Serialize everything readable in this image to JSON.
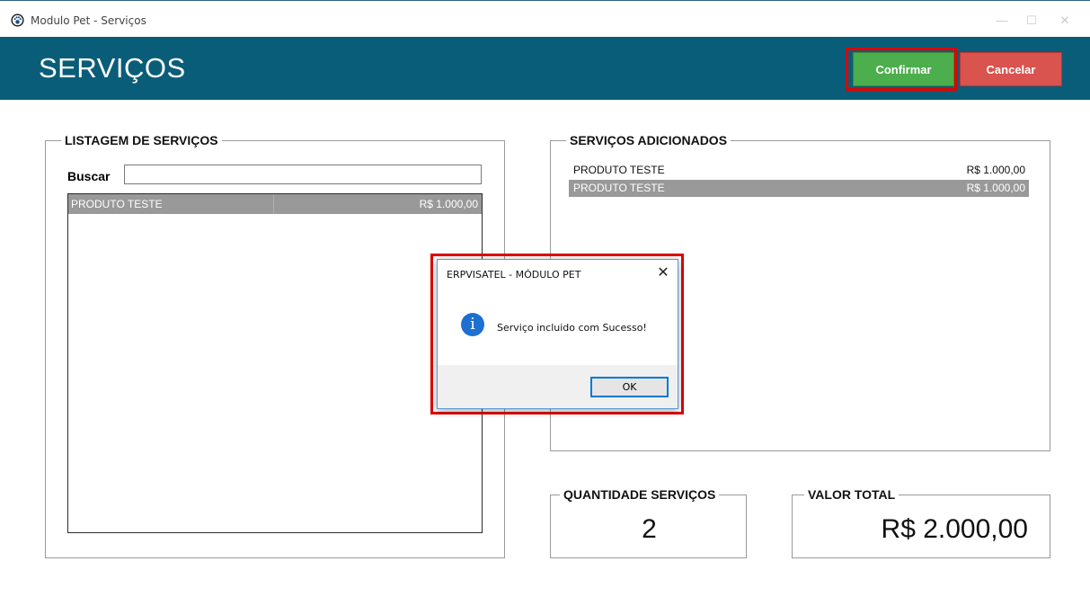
{
  "window": {
    "title": "Modulo Pet - Serviços",
    "minimize_glyph": "—",
    "maximize_glyph": "☐",
    "close_glyph": "✕"
  },
  "header": {
    "title": "SERVIÇOS",
    "confirm_label": "Confirmar",
    "cancel_label": "Cancelar"
  },
  "listagem": {
    "legend": "LISTAGEM DE SERVIÇOS",
    "search_label": "Buscar",
    "search_value": "",
    "rows": [
      {
        "name": "PRODUTO TESTE",
        "price": "R$ 1.000,00",
        "selected": true
      }
    ]
  },
  "adicionados": {
    "legend": "SERVIÇOS ADICIONADOS",
    "rows": [
      {
        "name": "PRODUTO TESTE",
        "price": "R$ 1.000,00",
        "selected": false
      },
      {
        "name": "PRODUTO TESTE",
        "price": "R$ 1.000,00",
        "selected": true
      }
    ]
  },
  "quantidade": {
    "legend": "QUANTIDADE SERVIÇOS",
    "value": "2"
  },
  "valor_total": {
    "legend": "VALOR TOTAL",
    "value": "R$ 2.000,00"
  },
  "dialog": {
    "title": "ERPVISATEL - MÓDULO PET",
    "close_glyph": "✕",
    "icon": "info-icon",
    "icon_glyph": "i",
    "message": "Serviço incluido com Sucesso!",
    "ok_label": "OK"
  },
  "colors": {
    "header_bg": "#0a5d78",
    "confirm": "#4cae4c",
    "cancel": "#d9534f",
    "highlight": "#e00000",
    "selected_row": "#999999"
  }
}
